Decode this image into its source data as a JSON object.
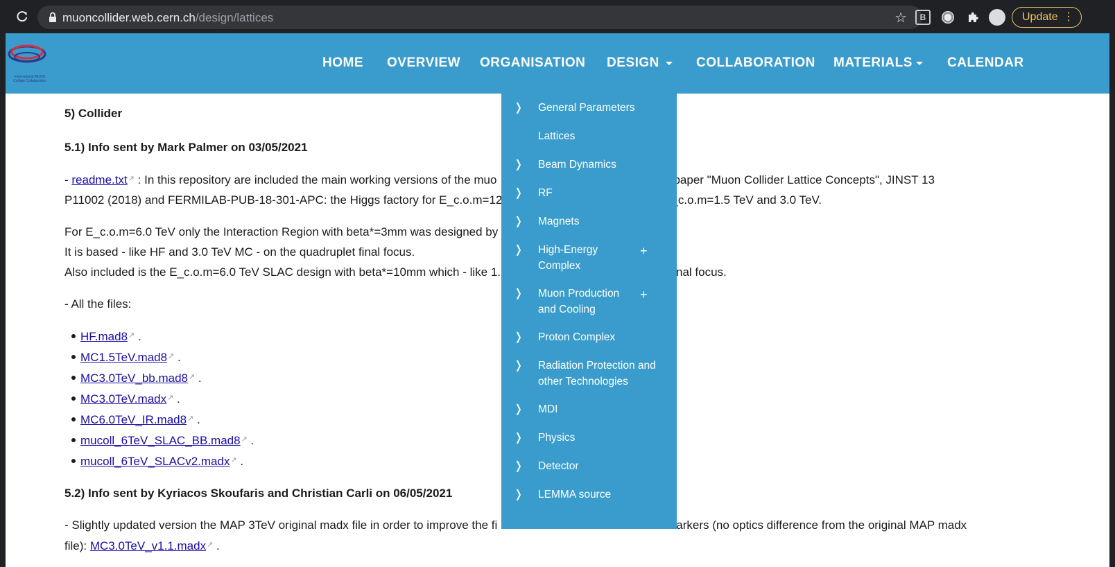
{
  "browser": {
    "url_host": "muoncollider.web.cern.ch",
    "url_path": "/design/lattices",
    "update_label": "Update",
    "ext_b_label": "B"
  },
  "site": {
    "logo_text": "International MUON Collider Collaboration",
    "nav": [
      {
        "label": "HOME"
      },
      {
        "label": "OVERVIEW"
      },
      {
        "label": "ORGANISATION"
      },
      {
        "label": "DESIGN"
      },
      {
        "label": "COLLABORATION"
      },
      {
        "label": "MATERIALS"
      },
      {
        "label": "CALENDAR"
      }
    ]
  },
  "dropdown": {
    "items": [
      {
        "label": "General Parameters",
        "chevron": "❭",
        "plus": ""
      },
      {
        "label": "Lattices",
        "chevron": "",
        "plus": ""
      },
      {
        "label": "Beam Dynamics",
        "chevron": "❭",
        "plus": ""
      },
      {
        "label": "RF",
        "chevron": "❭",
        "plus": ""
      },
      {
        "label": "Magnets",
        "chevron": "❭",
        "plus": ""
      },
      {
        "label": "High-Energy Complex",
        "chevron": "❭",
        "plus": "+"
      },
      {
        "label": "Muon Production and Cooling",
        "chevron": "❭",
        "plus": "+"
      },
      {
        "label": "Proton Complex",
        "chevron": "❭",
        "plus": ""
      },
      {
        "label": "Radiation Protection and other Technologies",
        "chevron": "❭",
        "plus": ""
      },
      {
        "label": "MDI",
        "chevron": "❭",
        "plus": ""
      },
      {
        "label": "Physics",
        "chevron": "❭",
        "plus": ""
      },
      {
        "label": "Detector",
        "chevron": "❭",
        "plus": ""
      },
      {
        "label": "LEMMA source",
        "chevron": "❭",
        "plus": ""
      }
    ]
  },
  "content": {
    "h5": "5) Collider",
    "h51": "5.1) Info sent by Mark Palmer on 03/05/2021",
    "readme_link": "readme.txt",
    "readme_text_a": " : In this repository are included the main working versions of the muo",
    "readme_text_b": "paper \"Muon Collider Lattice Concepts\", JINST 13",
    "readme_line2_a": "P11002 (2018) and FERMILAB-PUB-18-301-APC: the Higgs factory for E_c.o.m=125G",
    "readme_line2_b": "E_c.o.m=1.5 TeV and 3.0 TeV.",
    "para2_line1": "For E_c.o.m=6.0 TeV only the Interaction Region with beta*=3mm was designed by t",
    "para2_line2": "It is based - like HF and 3.0 TeV MC - on the quadruplet final focus.",
    "para2_line3_a": "Also included is the E_c.o.m=6.0 TeV SLAC design with beta*=10mm  which - like 1.5",
    "para2_line3_b": "final focus.",
    "all_files": "- All the files:",
    "files": [
      "HF.mad8",
      "MC1.5TeV.mad8",
      "MC3.0TeV_bb.mad8",
      "MC3.0TeV.madx",
      "MC6.0TeV_IR.mad8",
      "mucoll_6TeV_SLAC_BB.mad8",
      "mucoll_6TeV_SLACv2.madx"
    ],
    "h52": "5.2) Info sent by Kyriacos Skoufaris and Christian Carli on 06/05/2021",
    "para3_a": "- Slightly updated version the MAP 3TeV original madx file in order to improve the fi",
    "para3_b": "arkers (no optics difference from the original MAP madx",
    "para3_line2": "file): ",
    "para3_link": "MC3.0TeV_v1.1.madx",
    "dash": "- ",
    "period": " ."
  }
}
